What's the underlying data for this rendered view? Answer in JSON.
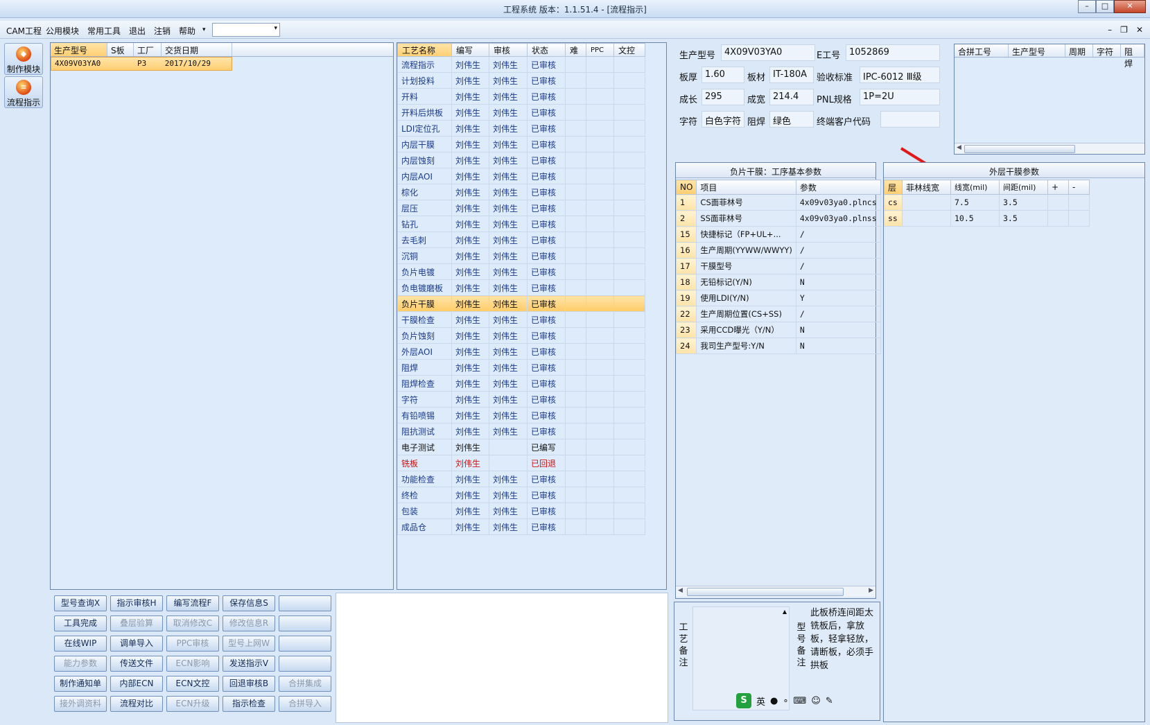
{
  "window": {
    "title": "工程系统   版本：1.1.51.4 - [流程指示]"
  },
  "menu": {
    "items": [
      "CAM工程",
      "公用模块",
      "常用工具",
      "退出",
      "注销",
      "帮助"
    ],
    "dropdown_arrow": "▾"
  },
  "left_tools": [
    {
      "label": "制作模块"
    },
    {
      "label": "流程指示"
    }
  ],
  "product_table": {
    "columns": [
      "生产型号",
      "S板",
      "工厂",
      "交货日期"
    ],
    "rows": [
      [
        "4X09V03YA0",
        "",
        "P3",
        "2017/10/29"
      ]
    ]
  },
  "process_table": {
    "columns": [
      "工艺名称",
      "编写",
      "审核",
      "状态",
      "难",
      "PPC",
      "文控"
    ],
    "rows": [
      [
        "流程指示",
        "刘伟生",
        "刘伟生",
        "已审核"
      ],
      [
        "计划投料",
        "刘伟生",
        "刘伟生",
        "已审核"
      ],
      [
        "开料",
        "刘伟生",
        "刘伟生",
        "已审核"
      ],
      [
        "开料后烘板",
        "刘伟生",
        "刘伟生",
        "已审核"
      ],
      [
        "LDI定位孔",
        "刘伟生",
        "刘伟生",
        "已审核"
      ],
      [
        "内层干膜",
        "刘伟生",
        "刘伟生",
        "已审核"
      ],
      [
        "内层蚀刻",
        "刘伟生",
        "刘伟生",
        "已审核"
      ],
      [
        "内层AOI",
        "刘伟生",
        "刘伟生",
        "已审核"
      ],
      [
        "棕化",
        "刘伟生",
        "刘伟生",
        "已审核"
      ],
      [
        "层压",
        "刘伟生",
        "刘伟生",
        "已审核"
      ],
      [
        "钻孔",
        "刘伟生",
        "刘伟生",
        "已审核"
      ],
      [
        "去毛刺",
        "刘伟生",
        "刘伟生",
        "已审核"
      ],
      [
        "沉铜",
        "刘伟生",
        "刘伟生",
        "已审核"
      ],
      [
        "负片电镀",
        "刘伟生",
        "刘伟生",
        "已审核"
      ],
      [
        "负电镀磨板",
        "刘伟生",
        "刘伟生",
        "已审核"
      ],
      [
        "负片干膜",
        "刘伟生",
        "刘伟生",
        "已审核"
      ],
      [
        "干膜检查",
        "刘伟生",
        "刘伟生",
        "已审核"
      ],
      [
        "负片蚀刻",
        "刘伟生",
        "刘伟生",
        "已审核"
      ],
      [
        "外层AOI",
        "刘伟生",
        "刘伟生",
        "已审核"
      ],
      [
        "阻焊",
        "刘伟生",
        "刘伟生",
        "已审核"
      ],
      [
        "阻焊检查",
        "刘伟生",
        "刘伟生",
        "已审核"
      ],
      [
        "字符",
        "刘伟生",
        "刘伟生",
        "已审核"
      ],
      [
        "有铅喷锡",
        "刘伟生",
        "刘伟生",
        "已审核"
      ],
      [
        "阻抗测试",
        "刘伟生",
        "刘伟生",
        "已审核"
      ],
      [
        "电子测试",
        "刘伟生",
        "",
        "已编写"
      ],
      [
        "铣板",
        "刘伟生",
        "",
        "已回退"
      ],
      [
        "功能检查",
        "刘伟生",
        "刘伟生",
        "已审核"
      ],
      [
        "终检",
        "刘伟生",
        "刘伟生",
        "已审核"
      ],
      [
        "包装",
        "刘伟生",
        "刘伟生",
        "已审核"
      ],
      [
        "成品仓",
        "刘伟生",
        "刘伟生",
        "已审核"
      ]
    ],
    "selected_index": 15,
    "returned_index": 25,
    "written_index": 24
  },
  "info": {
    "model_label": "生产型号",
    "model_value": "4X09V03YA0",
    "e_label": "E工号",
    "e_value": "1052869",
    "thick_label": "板厚",
    "thick_value": "1.60",
    "mat_label": "板材",
    "mat_value": "IT-180A",
    "std_label": "验收标准",
    "std_value": "IPC-6012 Ⅲ级",
    "len_label": "成长",
    "len_value": "295",
    "wid_label": "成宽",
    "wid_value": "214.4",
    "pnl_label": "PNL规格",
    "pnl_value": "1P=2U",
    "char_label": "字符",
    "char_value": "白色字符",
    "mask_label": "阻焊",
    "mask_value": "绿色",
    "cust_label": "终端客户代码",
    "cust_value": ""
  },
  "merge_table": {
    "columns": [
      "合拼工号",
      "生产型号",
      "周期",
      "字符",
      "阻焊"
    ]
  },
  "neg_film": {
    "caption": "负片干膜：工序基本参数",
    "columns": [
      "NO",
      "项目",
      "参数"
    ],
    "rows": [
      [
        "1",
        "CS面菲林号",
        "4x09v03ya0.plncs"
      ],
      [
        "2",
        "SS面菲林号",
        "4x09v03ya0.plnss"
      ],
      [
        "15",
        "快捷标记（FP+UL+...",
        "/"
      ],
      [
        "16",
        "生产周期(YYWW/WWYY)",
        "/"
      ],
      [
        "17",
        "干膜型号",
        "/"
      ],
      [
        "18",
        "无铅标记(Y/N)",
        "N"
      ],
      [
        "19",
        "使用LDI(Y/N)",
        "Y"
      ],
      [
        "22",
        "生产周期位置(CS+SS)",
        "/"
      ],
      [
        "23",
        "采用CCD曝光（Y/N）",
        "N"
      ],
      [
        "24",
        "我司生产型号:Y/N",
        "N"
      ]
    ]
  },
  "outer_film": {
    "caption": "外层干膜参数",
    "columns": [
      "层",
      "菲林线宽",
      "线宽(mil)",
      "间距(mil)",
      "+",
      "-"
    ],
    "rows": [
      [
        "cs",
        "",
        "7.5",
        "3.5",
        "",
        ""
      ],
      [
        "ss",
        "",
        "10.5",
        "3.5",
        "",
        ""
      ]
    ]
  },
  "remarks": {
    "process_label": "工艺备注",
    "model_label": "型号备注",
    "model_text": "此板桥连间距太铣板后，拿放板，轻拿轻放，请断板，必须手拱板"
  },
  "ime": {
    "logo": "S",
    "lang": "英"
  },
  "buttons": [
    [
      "型号查询X",
      "指示审核H",
      "编写流程F",
      "保存信息S",
      ""
    ],
    [
      "工具完成",
      "叠层验算",
      "取消修改C",
      "修改信息R",
      ""
    ],
    [
      "在线WIP",
      "调单导入",
      "PPC审核",
      "型号上网W",
      ""
    ],
    [
      "能力参数",
      "传送文件",
      "ECN影响",
      "发送指示V",
      ""
    ],
    [
      "制作通知单",
      "内部ECN",
      "ECN文控",
      "回退审核B",
      "合拼集成"
    ],
    [
      "接外调资料",
      "流程对比",
      "ECN升级",
      "指示检查",
      "合拼导入"
    ]
  ],
  "buttons_disabled": [
    [
      1,
      1
    ],
    [
      1,
      2
    ],
    [
      1,
      3
    ],
    [
      2,
      2
    ],
    [
      2,
      3
    ],
    [
      3,
      0
    ],
    [
      3,
      2
    ],
    [
      5,
      0
    ],
    [
      5,
      2
    ],
    [
      4,
      4
    ],
    [
      5,
      4
    ]
  ],
  "colors": {
    "selection": "#ffcf72",
    "returned": "#d01010",
    "link_text": "#1a3a8a",
    "arrow": "#e01818"
  }
}
